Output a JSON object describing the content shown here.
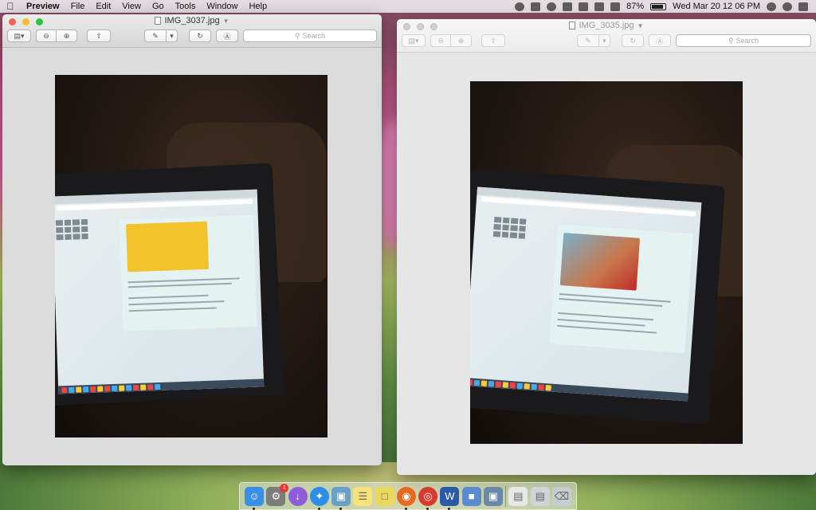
{
  "menubar": {
    "app_name": "Preview",
    "menus": [
      "File",
      "Edit",
      "View",
      "Go",
      "Tools",
      "Window",
      "Help"
    ],
    "battery_percent": "87%",
    "clock": "Wed Mar 20  12 06 PM"
  },
  "windows": [
    {
      "title": "IMG_3037.jpg",
      "active": true,
      "search_placeholder": "Search"
    },
    {
      "title": "IMG_3035.jpg",
      "active": false,
      "search_placeholder": "Search"
    }
  ],
  "dock": {
    "apps": [
      {
        "name": "Finder",
        "icon": "finder-icon",
        "color": "#3a8ee6",
        "running": true
      },
      {
        "name": "System Preferences",
        "icon": "gear-icon",
        "color": "#7c7c7c",
        "running": false,
        "badge": "1"
      },
      {
        "name": "Downloads",
        "icon": "download-icon",
        "color": "#8f5cd8",
        "running": false
      },
      {
        "name": "Safari",
        "icon": "compass-icon",
        "color": "#2d8ee6",
        "running": true
      },
      {
        "name": "Preview",
        "icon": "preview-icon",
        "color": "#6aa0c8",
        "running": true
      },
      {
        "name": "Notes",
        "icon": "notes-icon",
        "color": "#f5e27a",
        "running": false
      },
      {
        "name": "Stickies",
        "icon": "stickies-icon",
        "color": "#e9d85a",
        "running": false
      },
      {
        "name": "Firefox",
        "icon": "firefox-icon",
        "color": "#e66a1f",
        "running": true
      },
      {
        "name": "Chrome",
        "icon": "chrome-icon",
        "color": "#d93a2e",
        "running": true
      },
      {
        "name": "Word",
        "icon": "word-icon",
        "color": "#2b5ba8",
        "running": true
      },
      {
        "name": "Image Capture",
        "icon": "image-capture-icon",
        "color": "#5a8ad0",
        "running": false
      },
      {
        "name": "Photos",
        "icon": "photo-icon",
        "color": "#6a88a8",
        "running": false
      }
    ],
    "right_items": [
      {
        "name": "Documents stack",
        "icon": "stack-icon",
        "color": "#e8e8e8"
      },
      {
        "name": "Downloads stack",
        "icon": "stack-icon",
        "color": "#d0d4d8"
      },
      {
        "name": "Trash",
        "icon": "trash-icon",
        "color": "#c8ccd0"
      }
    ]
  }
}
